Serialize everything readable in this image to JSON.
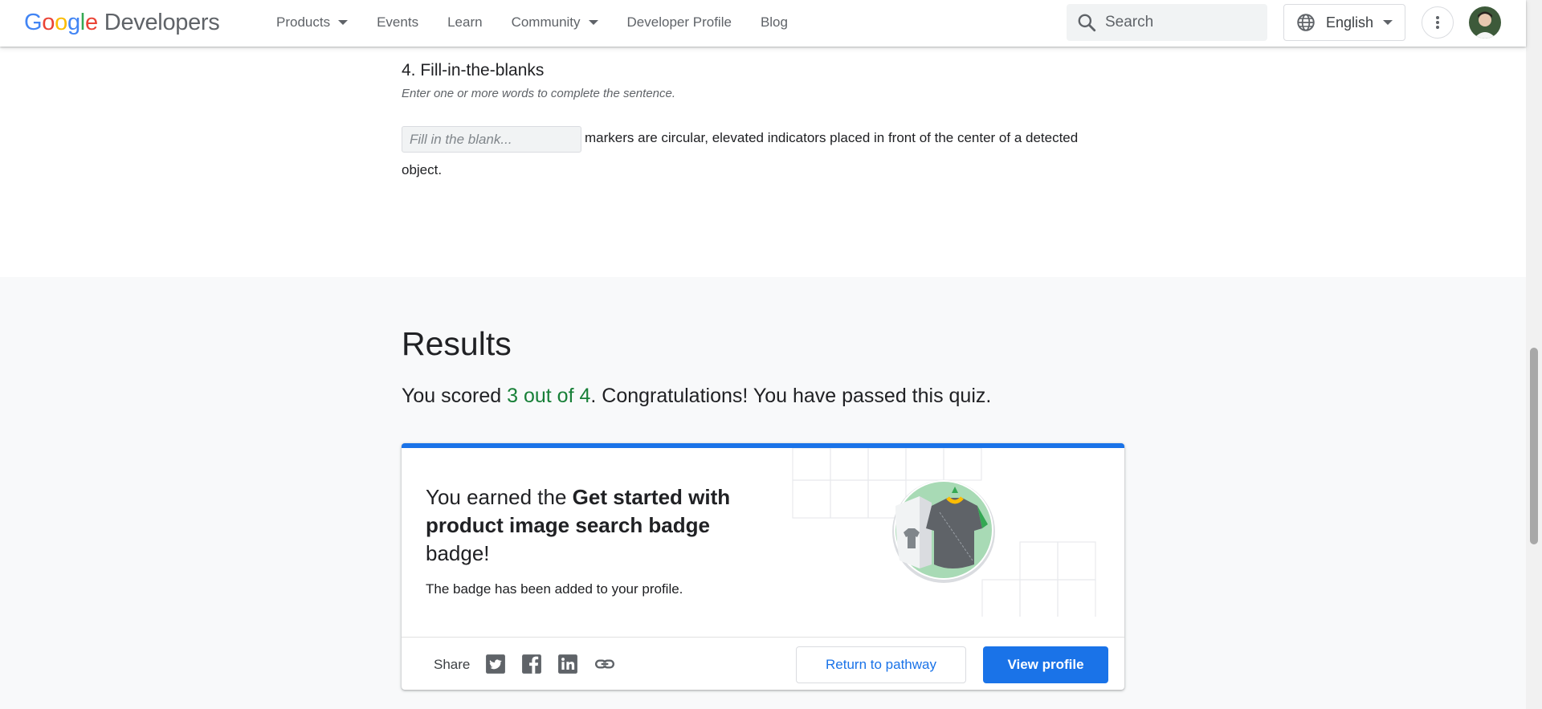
{
  "header": {
    "logo_text": "Developers",
    "nav": [
      {
        "label": "Products",
        "dropdown": true
      },
      {
        "label": "Events",
        "dropdown": false
      },
      {
        "label": "Learn",
        "dropdown": false
      },
      {
        "label": "Community",
        "dropdown": true
      },
      {
        "label": "Developer Profile",
        "dropdown": false
      },
      {
        "label": "Blog",
        "dropdown": false
      }
    ],
    "search_placeholder": "Search",
    "language": "English"
  },
  "question": {
    "title": "4. Fill-in-the-blanks",
    "hint": "Enter one or more words to complete the sentence.",
    "blank_placeholder": "Fill in the blank...",
    "sentence_part1": "markers are circular, elevated indicators placed in front of the center of a detected",
    "sentence_part2": "object."
  },
  "results": {
    "title": "Results",
    "score_prefix": "You scored ",
    "score_value": "3 out of 4",
    "score_suffix": ". Congratulations! You have passed this quiz."
  },
  "badge_card": {
    "earned_prefix": "You earned the ",
    "badge_name": "Get started with product image search badge",
    "earned_suffix": " badge!",
    "added_text": "The badge has been added to your profile.",
    "share_label": "Share",
    "share_icons": [
      "twitter-icon",
      "facebook-icon",
      "linkedin-icon",
      "link-icon"
    ],
    "return_label": "Return to pathway",
    "view_label": "View profile"
  },
  "colors": {
    "accent": "#1a73e8",
    "pass_green": "#188038",
    "results_bg": "#f8f9fa"
  }
}
